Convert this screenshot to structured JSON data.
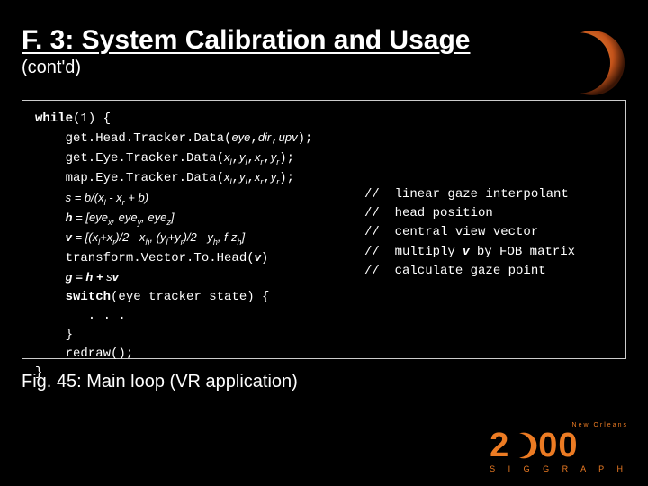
{
  "header": {
    "title": "F. 3: System Calibration and Usage",
    "subtitle": "(cont'd)"
  },
  "code": {
    "l0": "while",
    "l0b": "(1) {",
    "l1": "    get.Head.Tracker.Data(",
    "l1a": "eye",
    "l1b": ",",
    "l1c": "dir",
    "l1d": ",",
    "l1e": "upv",
    "l1f": ");",
    "l2": "    get.Eye.Tracker.Data(",
    "l2s1": "x",
    "l2s1s": "l",
    "l2c1": ",",
    "l2s2": "y",
    "l2s2s": "l",
    "l2c2": ",",
    "l2s3": "x",
    "l2s3s": "r",
    "l2c3": ",",
    "l2s4": "y",
    "l2s4s": "r",
    "l2e": ");",
    "l3": "    map.Eye.Tracker.Data(",
    "l4": "    ",
    "l4a": "s = b/(x",
    "l4as": "l",
    "l4b": " - x",
    "l4bs": "r",
    "l4c": " + b)",
    "l5": "    ",
    "l5a": "h",
    "l5b": " = [eye",
    "l5bs": "x",
    "l5c": ", eye",
    "l5cs": "y",
    "l5d": ", eye",
    "l5ds": "z",
    "l5e": "]",
    "l6": "    ",
    "l6a": "v",
    "l6b": " = [(x",
    "l6bs": "l",
    "l6c": "+x",
    "l6cs": "r",
    "l6d": ")/2 - x",
    "l6ds": "h",
    "l6e": ", (y",
    "l6es": "l",
    "l6f": "+y",
    "l6fs": "r",
    "l6g": ")/2 - y",
    "l6gs": "h",
    "l6h": ", f-z",
    "l6hs": "h",
    "l6i": "]",
    "l7": "    transform.Vector.To.Head(",
    "l7a": "v",
    "l7e": ")",
    "l8": "    ",
    "l8a": "g = h + ",
    "l8b": "s",
    "l8c": "v",
    "l9a": "    ",
    "l9b": "switch",
    "l9c": "(eye tracker state) {",
    "l10": "       . . .",
    "l11": "    }",
    "l12": "    redraw();",
    "l13": "}"
  },
  "comments": {
    "c1": "//  linear gaze interpolant",
    "c2": "//  head position",
    "c3": "//  central view vector",
    "c4": "//  multiply ",
    "c4v": "v",
    "c4b": " by FOB matrix",
    "c5": "//  calculate gaze point",
    "pad": "\n\n\n\n"
  },
  "caption": "Fig. 45: Main loop (VR application)",
  "footer": {
    "city": "New Orleans",
    "year_prefix": "2",
    "year_suffix": "0",
    "name": "S I G G R A P H"
  }
}
